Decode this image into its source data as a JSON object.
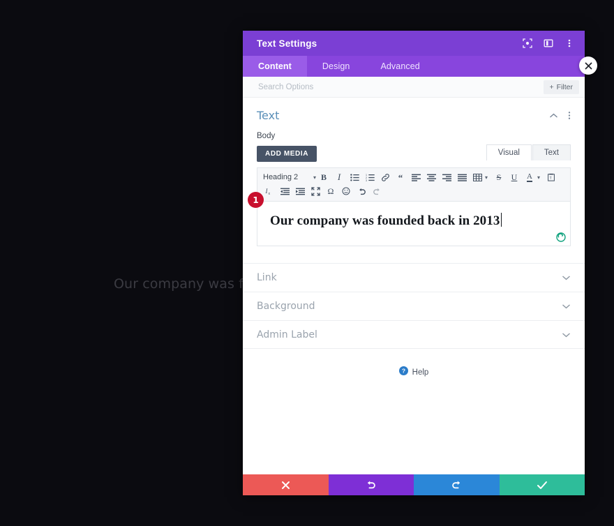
{
  "background_page": {
    "heading_text": "Our company was foun"
  },
  "modal": {
    "title": "Text Settings",
    "header_icons": [
      {
        "name": "fullscreen-expand-icon",
        "glyph": "expand"
      },
      {
        "name": "split-view-icon",
        "glyph": "split"
      },
      {
        "name": "more-options-icon",
        "glyph": "kebab"
      }
    ],
    "tabs": [
      {
        "label": "Content",
        "active": true
      },
      {
        "label": "Design",
        "active": false
      },
      {
        "label": "Advanced",
        "active": false
      }
    ],
    "search": {
      "value": "",
      "placeholder": "Search Options"
    },
    "filter_button": {
      "label": "Filter",
      "plus": "+"
    },
    "text_section": {
      "title": "Text",
      "collapse_icon": "chevron-up",
      "more_icon": "kebab",
      "field_label": "Body",
      "add_media_label": "ADD MEDIA",
      "editor_tabs": [
        {
          "label": "Visual",
          "active": true
        },
        {
          "label": "Text",
          "active": false
        }
      ],
      "format_select": "Heading 2",
      "toolbar_row1": [
        "bold-icon",
        "italic-icon",
        "bulleted-list-icon",
        "numbered-list-icon",
        "link-icon",
        "blockquote-icon",
        "align-left-icon",
        "align-center-icon",
        "align-right-icon",
        "align-justify-icon",
        "table-icon",
        "strikethrough-icon",
        "underline-icon",
        "text-color-icon",
        "paste-as-text-icon"
      ],
      "toolbar_row2": [
        "clear-formatting-icon",
        "outdent-icon",
        "indent-icon",
        "fullscreen-icon",
        "special-character-icon",
        "emoji-icon",
        "undo-icon",
        "redo-icon"
      ],
      "editor_content": "Our company was founded back in 2013",
      "step_badge": "1",
      "resize_icon": "resize-handle-icon"
    },
    "accordion": [
      {
        "label": "Link",
        "chevron": "chevron-down"
      },
      {
        "label": "Background",
        "chevron": "chevron-down"
      },
      {
        "label": "Admin Label",
        "chevron": "chevron-down"
      }
    ],
    "help": {
      "label": "Help",
      "icon": "help-question-icon"
    },
    "actions": [
      {
        "name": "cancel-button",
        "icon": "close-x-icon",
        "color": "#ec5956"
      },
      {
        "name": "undo-button",
        "icon": "undo-arrow-icon",
        "color": "#7e2fd6"
      },
      {
        "name": "redo-button",
        "icon": "redo-arrow-icon",
        "color": "#2b87d8"
      },
      {
        "name": "save-button",
        "icon": "checkmark-icon",
        "color": "#2ebd9a"
      }
    ],
    "close_button": {
      "name": "close-modal-button",
      "icon": "close-x-icon"
    }
  },
  "colors": {
    "header_purple": "#7b3fd4",
    "tabbar_purple": "#8845dd",
    "tab_active_purple": "#9a5ce8",
    "section_title_blue": "#5a8fb8",
    "badge_red": "#c8102e",
    "resize_green": "#12a37f"
  }
}
